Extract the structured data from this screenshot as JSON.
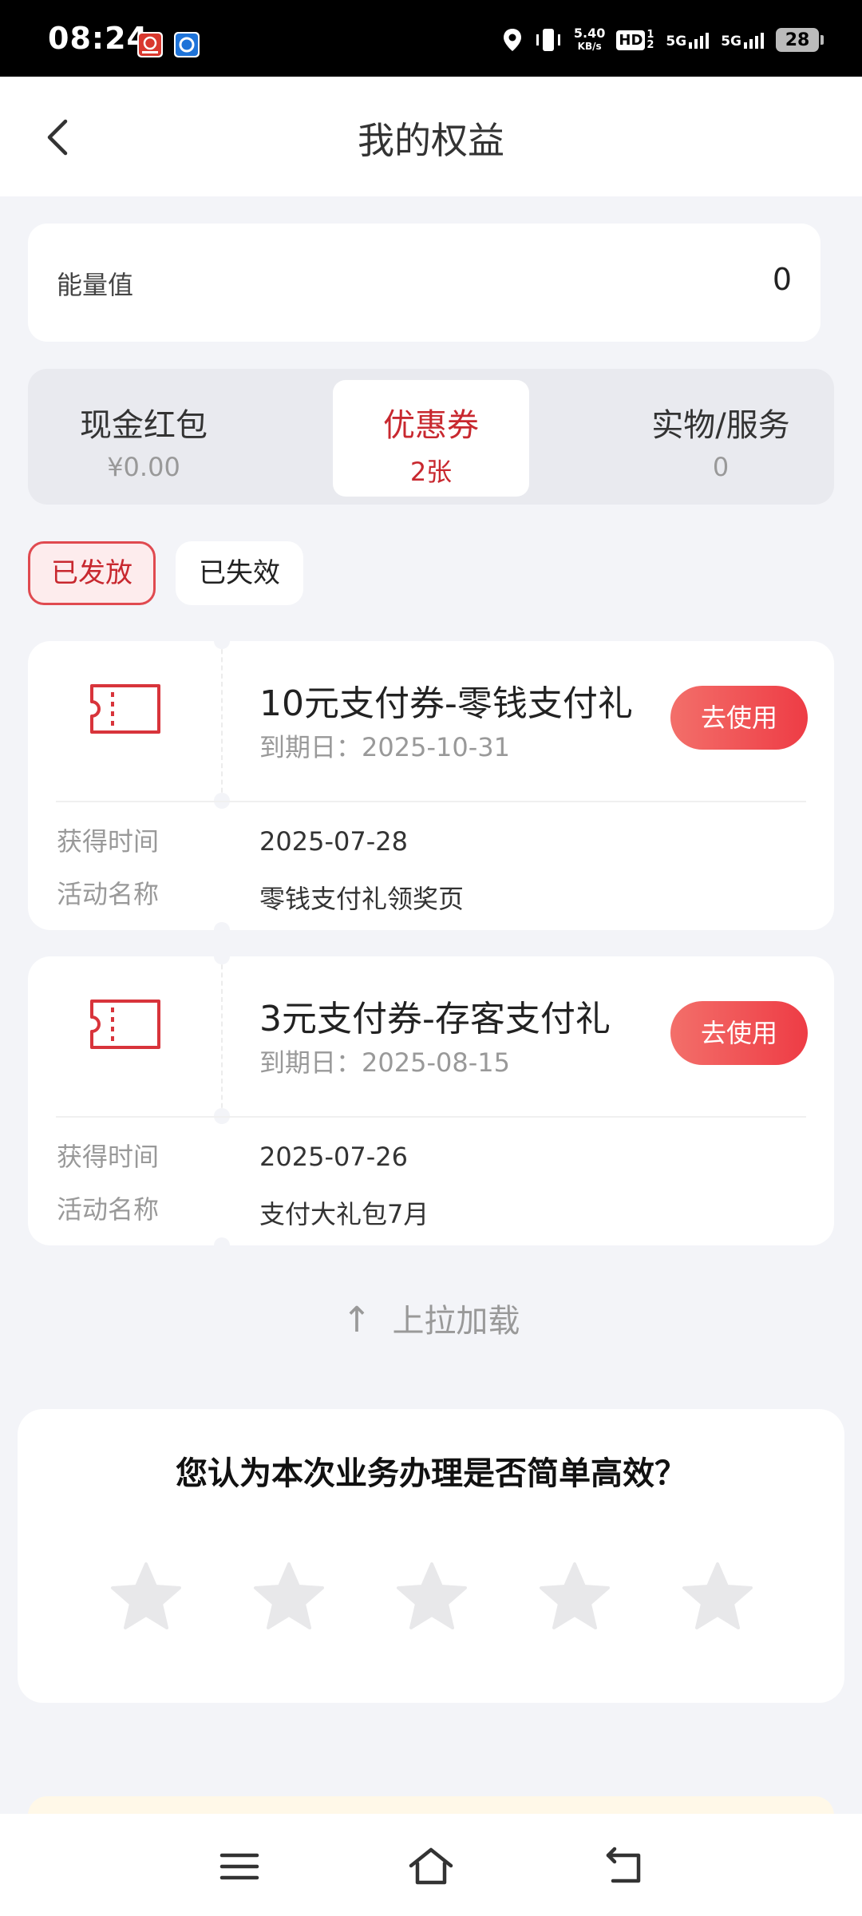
{
  "status_bar": {
    "time": "08:24",
    "net_speed_value": "5.40",
    "net_speed_unit": "KB/s",
    "hd_label": "HD",
    "hd_sub": "1 2",
    "signal1_label": "5G",
    "signal2_label": "5G",
    "battery": "28"
  },
  "header": {
    "title": "我的权益"
  },
  "energy": {
    "label": "能量值",
    "value": "0"
  },
  "type_tabs": [
    {
      "name": "现金红包",
      "count": "¥0.00"
    },
    {
      "name": "优惠券",
      "count": "2张"
    },
    {
      "name": "实物/服务",
      "count": "0"
    }
  ],
  "filters": [
    {
      "label": "已发放"
    },
    {
      "label": "已失效"
    }
  ],
  "coupons": [
    {
      "title": "10元支付券-零钱支付礼",
      "expiry": "到期日：2025-10-31",
      "button": "去使用",
      "obtained_label": "获得时间",
      "obtained_value": "2025-07-28",
      "activity_label": "活动名称",
      "activity_value": "零钱支付礼领奖页"
    },
    {
      "title": "3元支付券-存客支付礼",
      "expiry": "到期日：2025-08-15",
      "button": "去使用",
      "obtained_label": "获得时间",
      "obtained_value": "2025-07-26",
      "activity_label": "活动名称",
      "activity_value": "支付大礼包7月"
    }
  ],
  "load_more": {
    "arrow": "↑",
    "label": "上拉加载"
  },
  "survey": {
    "question": "您认为本次业务办理是否简单高效？",
    "rating": 0,
    "max_rating": 5
  },
  "colors": {
    "accent": "#c8282f",
    "button_gradient_start": "#f36f6a",
    "button_gradient_end": "#ee3c45",
    "background": "#f3f4f8"
  }
}
